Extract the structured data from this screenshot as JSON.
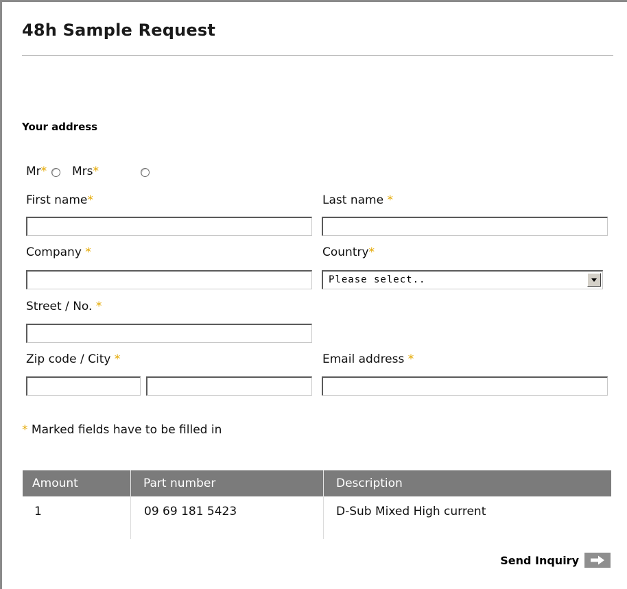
{
  "header": {
    "title": "48h Sample Request"
  },
  "section": {
    "title": "Your address"
  },
  "salutation": {
    "mr_label": "Mr",
    "mrs_label": "Mrs",
    "required_mark": "*"
  },
  "fields": {
    "first_name": {
      "label": "First name",
      "value": ""
    },
    "last_name": {
      "label": "Last name ",
      "value": ""
    },
    "company": {
      "label": "Company ",
      "value": ""
    },
    "country": {
      "label": "Country",
      "selected": "Please select.."
    },
    "street": {
      "label": "Street / No. ",
      "value": ""
    },
    "zip_city": {
      "label": "Zip code / City ",
      "zip_value": "",
      "city_value": ""
    },
    "email": {
      "label": "Email address ",
      "value": ""
    }
  },
  "required_note": " Marked fields have to be filled in",
  "table": {
    "headers": [
      "Amount",
      "Part number",
      "Description"
    ],
    "rows": [
      {
        "amount": "1",
        "part_number": "09 69 181 5423",
        "description": "D-Sub Mixed High current"
      }
    ]
  },
  "actions": {
    "send_label": "Send Inquiry"
  },
  "colors": {
    "required_star": "#e4a800",
    "table_header_bg": "#7b7b7b"
  },
  "icons": {
    "send": "arrow-right-icon",
    "select": "chevron-down-icon"
  }
}
